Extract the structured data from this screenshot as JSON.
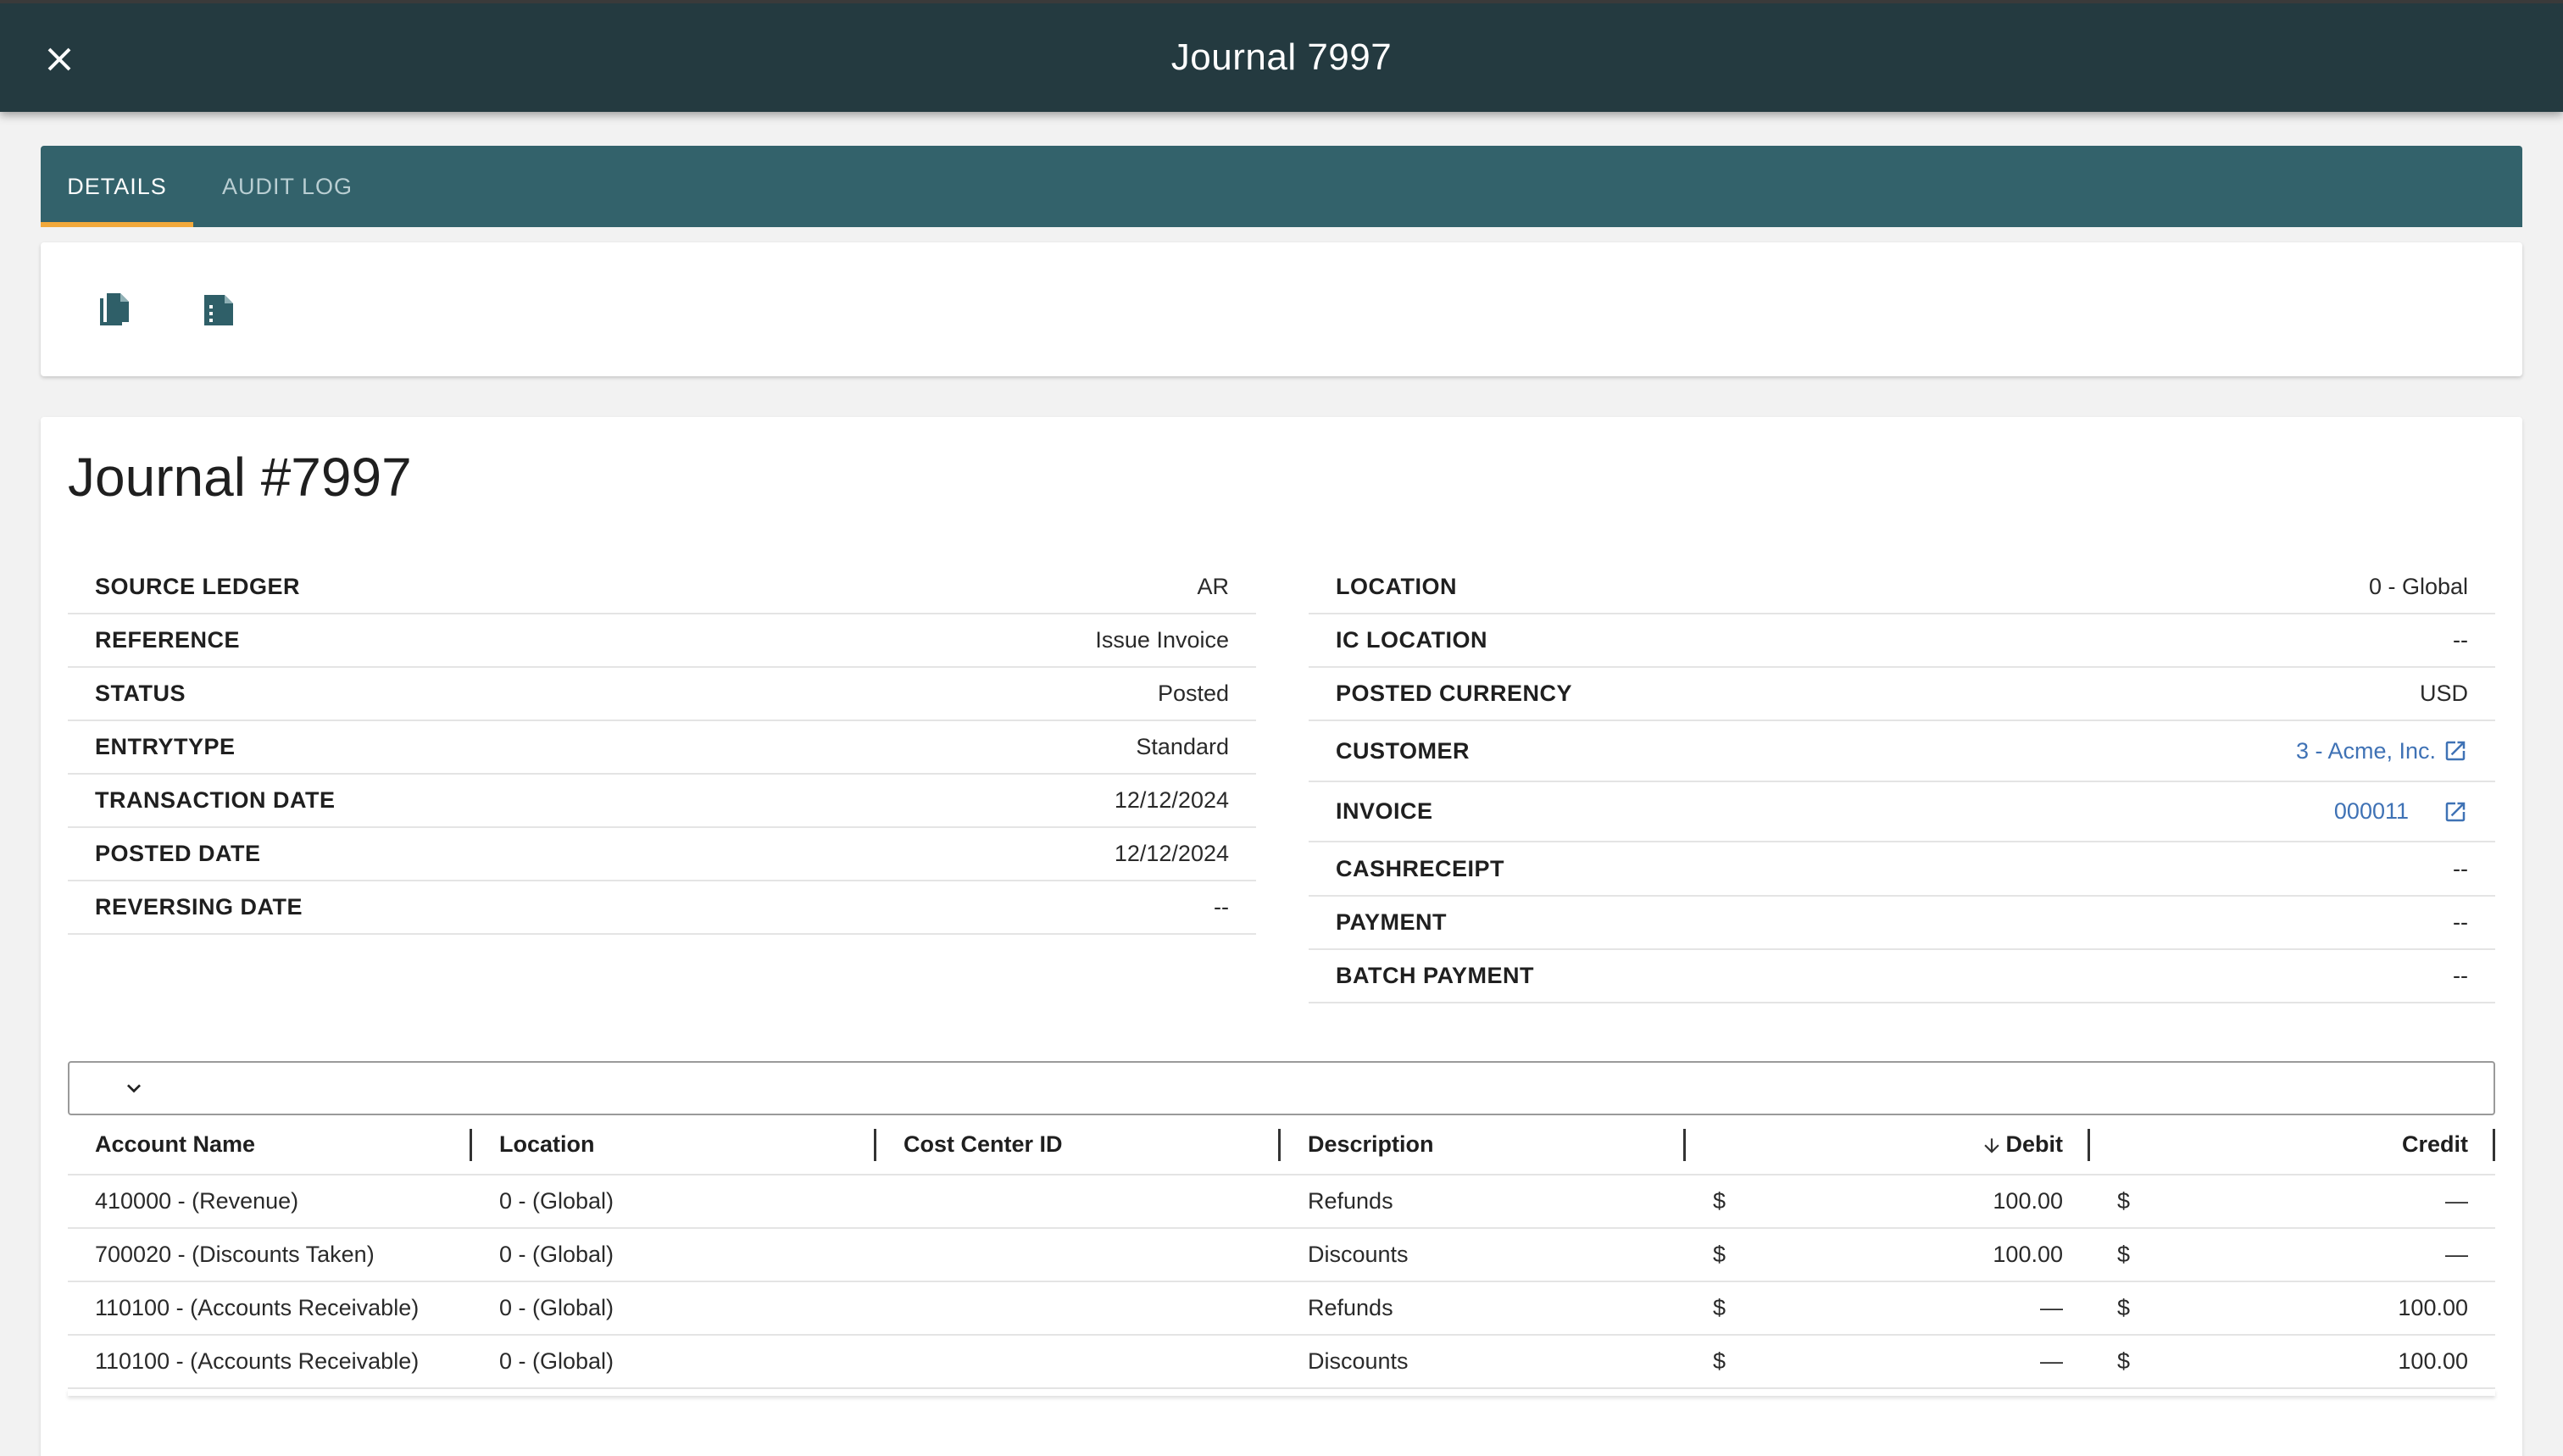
{
  "header": {
    "title": "Journal 7997",
    "close_icon": "close-icon"
  },
  "tabs": [
    {
      "label": "DETAILS",
      "active": true
    },
    {
      "label": "AUDIT LOG",
      "active": false
    }
  ],
  "toolbar": {
    "icons": [
      "copy-document-icon",
      "document-details-icon"
    ]
  },
  "journal": {
    "heading": "Journal #7997"
  },
  "details_left": [
    {
      "label": "SOURCE LEDGER",
      "value": "AR"
    },
    {
      "label": "REFERENCE",
      "value": "Issue Invoice"
    },
    {
      "label": "STATUS",
      "value": "Posted"
    },
    {
      "label": "ENTRYTYPE",
      "value": "Standard"
    },
    {
      "label": "TRANSACTION DATE",
      "value": "12/12/2024"
    },
    {
      "label": "POSTED DATE",
      "value": "12/12/2024"
    },
    {
      "label": "REVERSING DATE",
      "value": "--"
    }
  ],
  "details_right": [
    {
      "label": "LOCATION",
      "value": "0 - Global"
    },
    {
      "label": "IC LOCATION",
      "value": "--"
    },
    {
      "label": "POSTED CURRENCY",
      "value": "USD"
    },
    {
      "label": "CUSTOMER",
      "value": "3 - Acme, Inc."
    },
    {
      "label": "INVOICE",
      "value": "000011"
    },
    {
      "label": "CASHRECEIPT",
      "value": "--"
    },
    {
      "label": "PAYMENT",
      "value": "--"
    },
    {
      "label": "BATCH PAYMENT",
      "value": "--"
    }
  ],
  "grid": {
    "columns": [
      "Account Name",
      "Location",
      "Cost Center ID",
      "Description",
      "Debit",
      "Credit"
    ],
    "currency_symbol": "$",
    "rows": [
      {
        "account": "410000 - (Revenue)",
        "location": "0 - (Global)",
        "cost_center": "",
        "description": "Refunds",
        "debit": "100.00",
        "credit": "—"
      },
      {
        "account": "700020 - (Discounts Taken)",
        "location": "0 - (Global)",
        "cost_center": "",
        "description": "Discounts",
        "debit": "100.00",
        "credit": "—"
      },
      {
        "account": "110100 - (Accounts Receivable)",
        "location": "0 - (Global)",
        "cost_center": "",
        "description": "Refunds",
        "debit": "—",
        "credit": "100.00"
      },
      {
        "account": "110100 - (Accounts Receivable)",
        "location": "0 - (Global)",
        "cost_center": "",
        "description": "Discounts",
        "debit": "—",
        "credit": "100.00"
      }
    ]
  },
  "colors": {
    "header_bg": "#243a40",
    "tabs_bg": "#33626b",
    "tab_indicator": "#f2a93b",
    "link": "#3f72b5"
  }
}
